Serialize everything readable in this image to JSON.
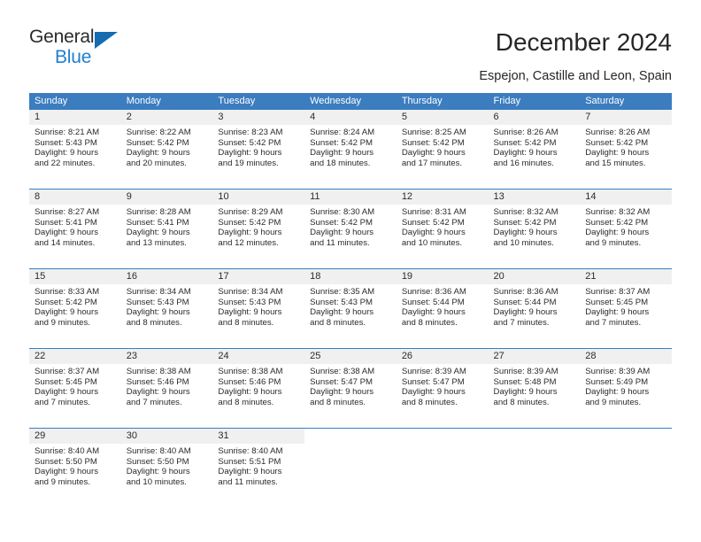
{
  "brand": {
    "name_top": "General",
    "name_bottom": "Blue",
    "triangle_color": "#156cb1",
    "blue_text_color": "#1f7fd0"
  },
  "header": {
    "title": "December 2024",
    "subtitle": "Espejon, Castille and Leon, Spain"
  },
  "theme": {
    "header_blue": "#3b7dbf",
    "daynum_gray": "#f0f0f0",
    "text_color": "#2b2b2b"
  },
  "labels": {
    "sunrise_prefix": "Sunrise:",
    "sunset_prefix": "Sunset:",
    "daylight_prefix": "Daylight:"
  },
  "weekdays": [
    "Sunday",
    "Monday",
    "Tuesday",
    "Wednesday",
    "Thursday",
    "Friday",
    "Saturday"
  ],
  "weeks": [
    [
      {
        "day": "1",
        "sunrise": "Sunrise: 8:21 AM",
        "sunset": "Sunset: 5:43 PM",
        "daylight_line1": "Daylight: 9 hours",
        "daylight_line2": "and 22 minutes."
      },
      {
        "day": "2",
        "sunrise": "Sunrise: 8:22 AM",
        "sunset": "Sunset: 5:42 PM",
        "daylight_line1": "Daylight: 9 hours",
        "daylight_line2": "and 20 minutes."
      },
      {
        "day": "3",
        "sunrise": "Sunrise: 8:23 AM",
        "sunset": "Sunset: 5:42 PM",
        "daylight_line1": "Daylight: 9 hours",
        "daylight_line2": "and 19 minutes."
      },
      {
        "day": "4",
        "sunrise": "Sunrise: 8:24 AM",
        "sunset": "Sunset: 5:42 PM",
        "daylight_line1": "Daylight: 9 hours",
        "daylight_line2": "and 18 minutes."
      },
      {
        "day": "5",
        "sunrise": "Sunrise: 8:25 AM",
        "sunset": "Sunset: 5:42 PM",
        "daylight_line1": "Daylight: 9 hours",
        "daylight_line2": "and 17 minutes."
      },
      {
        "day": "6",
        "sunrise": "Sunrise: 8:26 AM",
        "sunset": "Sunset: 5:42 PM",
        "daylight_line1": "Daylight: 9 hours",
        "daylight_line2": "and 16 minutes."
      },
      {
        "day": "7",
        "sunrise": "Sunrise: 8:26 AM",
        "sunset": "Sunset: 5:42 PM",
        "daylight_line1": "Daylight: 9 hours",
        "daylight_line2": "and 15 minutes."
      }
    ],
    [
      {
        "day": "8",
        "sunrise": "Sunrise: 8:27 AM",
        "sunset": "Sunset: 5:41 PM",
        "daylight_line1": "Daylight: 9 hours",
        "daylight_line2": "and 14 minutes."
      },
      {
        "day": "9",
        "sunrise": "Sunrise: 8:28 AM",
        "sunset": "Sunset: 5:41 PM",
        "daylight_line1": "Daylight: 9 hours",
        "daylight_line2": "and 13 minutes."
      },
      {
        "day": "10",
        "sunrise": "Sunrise: 8:29 AM",
        "sunset": "Sunset: 5:42 PM",
        "daylight_line1": "Daylight: 9 hours",
        "daylight_line2": "and 12 minutes."
      },
      {
        "day": "11",
        "sunrise": "Sunrise: 8:30 AM",
        "sunset": "Sunset: 5:42 PM",
        "daylight_line1": "Daylight: 9 hours",
        "daylight_line2": "and 11 minutes."
      },
      {
        "day": "12",
        "sunrise": "Sunrise: 8:31 AM",
        "sunset": "Sunset: 5:42 PM",
        "daylight_line1": "Daylight: 9 hours",
        "daylight_line2": "and 10 minutes."
      },
      {
        "day": "13",
        "sunrise": "Sunrise: 8:32 AM",
        "sunset": "Sunset: 5:42 PM",
        "daylight_line1": "Daylight: 9 hours",
        "daylight_line2": "and 10 minutes."
      },
      {
        "day": "14",
        "sunrise": "Sunrise: 8:32 AM",
        "sunset": "Sunset: 5:42 PM",
        "daylight_line1": "Daylight: 9 hours",
        "daylight_line2": "and 9 minutes."
      }
    ],
    [
      {
        "day": "15",
        "sunrise": "Sunrise: 8:33 AM",
        "sunset": "Sunset: 5:42 PM",
        "daylight_line1": "Daylight: 9 hours",
        "daylight_line2": "and 9 minutes."
      },
      {
        "day": "16",
        "sunrise": "Sunrise: 8:34 AM",
        "sunset": "Sunset: 5:43 PM",
        "daylight_line1": "Daylight: 9 hours",
        "daylight_line2": "and 8 minutes."
      },
      {
        "day": "17",
        "sunrise": "Sunrise: 8:34 AM",
        "sunset": "Sunset: 5:43 PM",
        "daylight_line1": "Daylight: 9 hours",
        "daylight_line2": "and 8 minutes."
      },
      {
        "day": "18",
        "sunrise": "Sunrise: 8:35 AM",
        "sunset": "Sunset: 5:43 PM",
        "daylight_line1": "Daylight: 9 hours",
        "daylight_line2": "and 8 minutes."
      },
      {
        "day": "19",
        "sunrise": "Sunrise: 8:36 AM",
        "sunset": "Sunset: 5:44 PM",
        "daylight_line1": "Daylight: 9 hours",
        "daylight_line2": "and 8 minutes."
      },
      {
        "day": "20",
        "sunrise": "Sunrise: 8:36 AM",
        "sunset": "Sunset: 5:44 PM",
        "daylight_line1": "Daylight: 9 hours",
        "daylight_line2": "and 7 minutes."
      },
      {
        "day": "21",
        "sunrise": "Sunrise: 8:37 AM",
        "sunset": "Sunset: 5:45 PM",
        "daylight_line1": "Daylight: 9 hours",
        "daylight_line2": "and 7 minutes."
      }
    ],
    [
      {
        "day": "22",
        "sunrise": "Sunrise: 8:37 AM",
        "sunset": "Sunset: 5:45 PM",
        "daylight_line1": "Daylight: 9 hours",
        "daylight_line2": "and 7 minutes."
      },
      {
        "day": "23",
        "sunrise": "Sunrise: 8:38 AM",
        "sunset": "Sunset: 5:46 PM",
        "daylight_line1": "Daylight: 9 hours",
        "daylight_line2": "and 7 minutes."
      },
      {
        "day": "24",
        "sunrise": "Sunrise: 8:38 AM",
        "sunset": "Sunset: 5:46 PM",
        "daylight_line1": "Daylight: 9 hours",
        "daylight_line2": "and 8 minutes."
      },
      {
        "day": "25",
        "sunrise": "Sunrise: 8:38 AM",
        "sunset": "Sunset: 5:47 PM",
        "daylight_line1": "Daylight: 9 hours",
        "daylight_line2": "and 8 minutes."
      },
      {
        "day": "26",
        "sunrise": "Sunrise: 8:39 AM",
        "sunset": "Sunset: 5:47 PM",
        "daylight_line1": "Daylight: 9 hours",
        "daylight_line2": "and 8 minutes."
      },
      {
        "day": "27",
        "sunrise": "Sunrise: 8:39 AM",
        "sunset": "Sunset: 5:48 PM",
        "daylight_line1": "Daylight: 9 hours",
        "daylight_line2": "and 8 minutes."
      },
      {
        "day": "28",
        "sunrise": "Sunrise: 8:39 AM",
        "sunset": "Sunset: 5:49 PM",
        "daylight_line1": "Daylight: 9 hours",
        "daylight_line2": "and 9 minutes."
      }
    ],
    [
      {
        "day": "29",
        "sunrise": "Sunrise: 8:40 AM",
        "sunset": "Sunset: 5:50 PM",
        "daylight_line1": "Daylight: 9 hours",
        "daylight_line2": "and 9 minutes."
      },
      {
        "day": "30",
        "sunrise": "Sunrise: 8:40 AM",
        "sunset": "Sunset: 5:50 PM",
        "daylight_line1": "Daylight: 9 hours",
        "daylight_line2": "and 10 minutes."
      },
      {
        "day": "31",
        "sunrise": "Sunrise: 8:40 AM",
        "sunset": "Sunset: 5:51 PM",
        "daylight_line1": "Daylight: 9 hours",
        "daylight_line2": "and 11 minutes."
      },
      {
        "day": "",
        "sunrise": "",
        "sunset": "",
        "daylight_line1": "",
        "daylight_line2": ""
      },
      {
        "day": "",
        "sunrise": "",
        "sunset": "",
        "daylight_line1": "",
        "daylight_line2": ""
      },
      {
        "day": "",
        "sunrise": "",
        "sunset": "",
        "daylight_line1": "",
        "daylight_line2": ""
      },
      {
        "day": "",
        "sunrise": "",
        "sunset": "",
        "daylight_line1": "",
        "daylight_line2": ""
      }
    ]
  ]
}
